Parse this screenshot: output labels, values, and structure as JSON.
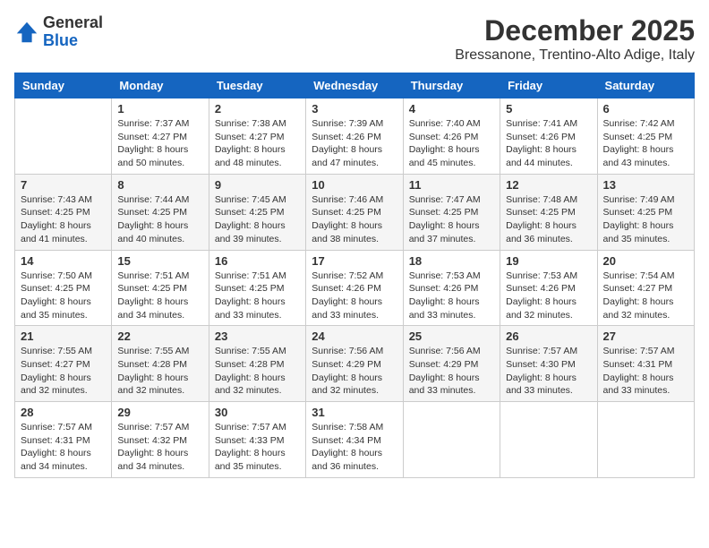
{
  "header": {
    "logo": {
      "line1": "General",
      "line2": "Blue"
    },
    "month_year": "December 2025",
    "location": "Bressanone, Trentino-Alto Adige, Italy"
  },
  "weekdays": [
    "Sunday",
    "Monday",
    "Tuesday",
    "Wednesday",
    "Thursday",
    "Friday",
    "Saturday"
  ],
  "weeks": [
    [
      {
        "day": "",
        "empty": true
      },
      {
        "day": "1",
        "sunrise": "7:37 AM",
        "sunset": "4:27 PM",
        "daylight": "8 hours and 50 minutes."
      },
      {
        "day": "2",
        "sunrise": "7:38 AM",
        "sunset": "4:27 PM",
        "daylight": "8 hours and 48 minutes."
      },
      {
        "day": "3",
        "sunrise": "7:39 AM",
        "sunset": "4:26 PM",
        "daylight": "8 hours and 47 minutes."
      },
      {
        "day": "4",
        "sunrise": "7:40 AM",
        "sunset": "4:26 PM",
        "daylight": "8 hours and 45 minutes."
      },
      {
        "day": "5",
        "sunrise": "7:41 AM",
        "sunset": "4:26 PM",
        "daylight": "8 hours and 44 minutes."
      },
      {
        "day": "6",
        "sunrise": "7:42 AM",
        "sunset": "4:25 PM",
        "daylight": "8 hours and 43 minutes."
      }
    ],
    [
      {
        "day": "7",
        "sunrise": "7:43 AM",
        "sunset": "4:25 PM",
        "daylight": "8 hours and 41 minutes."
      },
      {
        "day": "8",
        "sunrise": "7:44 AM",
        "sunset": "4:25 PM",
        "daylight": "8 hours and 40 minutes."
      },
      {
        "day": "9",
        "sunrise": "7:45 AM",
        "sunset": "4:25 PM",
        "daylight": "8 hours and 39 minutes."
      },
      {
        "day": "10",
        "sunrise": "7:46 AM",
        "sunset": "4:25 PM",
        "daylight": "8 hours and 38 minutes."
      },
      {
        "day": "11",
        "sunrise": "7:47 AM",
        "sunset": "4:25 PM",
        "daylight": "8 hours and 37 minutes."
      },
      {
        "day": "12",
        "sunrise": "7:48 AM",
        "sunset": "4:25 PM",
        "daylight": "8 hours and 36 minutes."
      },
      {
        "day": "13",
        "sunrise": "7:49 AM",
        "sunset": "4:25 PM",
        "daylight": "8 hours and 35 minutes."
      }
    ],
    [
      {
        "day": "14",
        "sunrise": "7:50 AM",
        "sunset": "4:25 PM",
        "daylight": "8 hours and 35 minutes."
      },
      {
        "day": "15",
        "sunrise": "7:51 AM",
        "sunset": "4:25 PM",
        "daylight": "8 hours and 34 minutes."
      },
      {
        "day": "16",
        "sunrise": "7:51 AM",
        "sunset": "4:25 PM",
        "daylight": "8 hours and 33 minutes."
      },
      {
        "day": "17",
        "sunrise": "7:52 AM",
        "sunset": "4:26 PM",
        "daylight": "8 hours and 33 minutes."
      },
      {
        "day": "18",
        "sunrise": "7:53 AM",
        "sunset": "4:26 PM",
        "daylight": "8 hours and 33 minutes."
      },
      {
        "day": "19",
        "sunrise": "7:53 AM",
        "sunset": "4:26 PM",
        "daylight": "8 hours and 32 minutes."
      },
      {
        "day": "20",
        "sunrise": "7:54 AM",
        "sunset": "4:27 PM",
        "daylight": "8 hours and 32 minutes."
      }
    ],
    [
      {
        "day": "21",
        "sunrise": "7:55 AM",
        "sunset": "4:27 PM",
        "daylight": "8 hours and 32 minutes."
      },
      {
        "day": "22",
        "sunrise": "7:55 AM",
        "sunset": "4:28 PM",
        "daylight": "8 hours and 32 minutes."
      },
      {
        "day": "23",
        "sunrise": "7:55 AM",
        "sunset": "4:28 PM",
        "daylight": "8 hours and 32 minutes."
      },
      {
        "day": "24",
        "sunrise": "7:56 AM",
        "sunset": "4:29 PM",
        "daylight": "8 hours and 32 minutes."
      },
      {
        "day": "25",
        "sunrise": "7:56 AM",
        "sunset": "4:29 PM",
        "daylight": "8 hours and 33 minutes."
      },
      {
        "day": "26",
        "sunrise": "7:57 AM",
        "sunset": "4:30 PM",
        "daylight": "8 hours and 33 minutes."
      },
      {
        "day": "27",
        "sunrise": "7:57 AM",
        "sunset": "4:31 PM",
        "daylight": "8 hours and 33 minutes."
      }
    ],
    [
      {
        "day": "28",
        "sunrise": "7:57 AM",
        "sunset": "4:31 PM",
        "daylight": "8 hours and 34 minutes."
      },
      {
        "day": "29",
        "sunrise": "7:57 AM",
        "sunset": "4:32 PM",
        "daylight": "8 hours and 34 minutes."
      },
      {
        "day": "30",
        "sunrise": "7:57 AM",
        "sunset": "4:33 PM",
        "daylight": "8 hours and 35 minutes."
      },
      {
        "day": "31",
        "sunrise": "7:58 AM",
        "sunset": "4:34 PM",
        "daylight": "8 hours and 36 minutes."
      },
      {
        "day": "",
        "empty": true
      },
      {
        "day": "",
        "empty": true
      },
      {
        "day": "",
        "empty": true
      }
    ]
  ]
}
